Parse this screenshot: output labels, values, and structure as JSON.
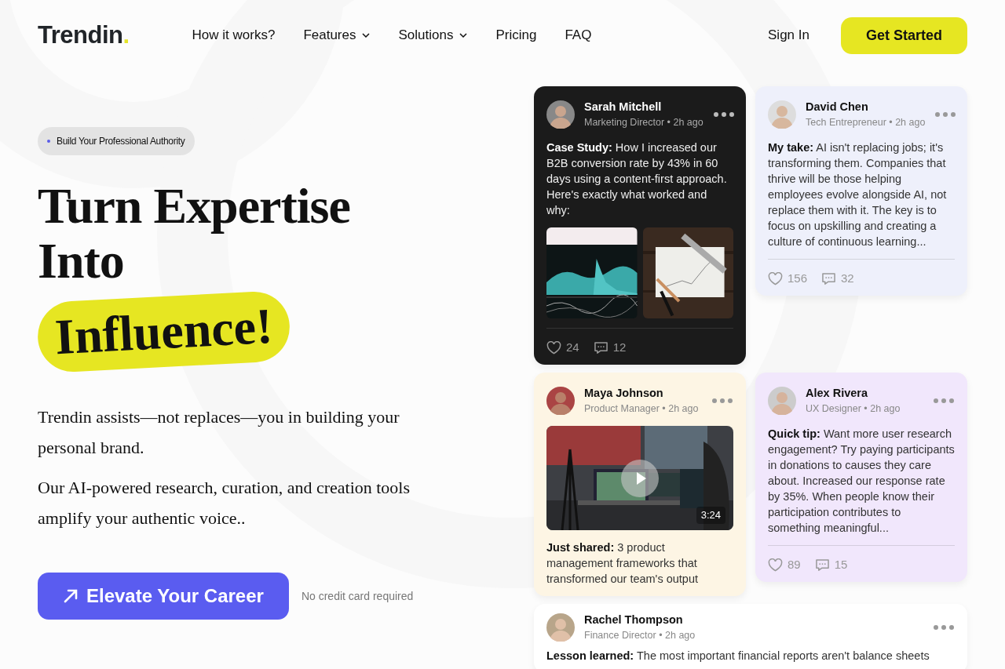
{
  "brand": {
    "name": "Trendin",
    "dot": "."
  },
  "nav": [
    {
      "label": "How it works?",
      "dropdown": false
    },
    {
      "label": "Features",
      "dropdown": true
    },
    {
      "label": "Solutions",
      "dropdown": true
    },
    {
      "label": "Pricing",
      "dropdown": false
    },
    {
      "label": "FAQ",
      "dropdown": false
    }
  ],
  "sign_in": "Sign In",
  "get_started": "Get Started",
  "hero": {
    "badge": "Build Your Professional Authority",
    "title": "Turn Expertise Into",
    "highlight": "Influence!",
    "paragraphs": [
      "Trendin assists—not replaces—you in building your personal brand.",
      "Our AI-powered research, curation, and creation tools amplify your authentic voice.."
    ],
    "cta": "Elevate Your Career",
    "note": "No credit card required"
  },
  "posts": [
    {
      "color": "#1b1b1b",
      "author": "Sarah Mitchell",
      "meta": "Marketing Director • 2h ago",
      "text": "**Case Study:** How I increased our B2B conversion rate by 43% in 60 days using a content-first approach. Here's exactly what worked and why:",
      "media": {
        "kind": "images"
      },
      "likes": "24",
      "comments": "12"
    },
    {
      "color": "#eef0fb",
      "author": "David Chen",
      "meta": "Tech Entrepreneur • 2h ago",
      "text": "**My take:** AI isn't replacing jobs; it's transforming them. Companies that thrive will be those helping employees evolve alongside AI, not replace them with it. The key is to focus on upskilling and creating a culture of continuous learning...",
      "likes": "156",
      "comments": "32"
    },
    {
      "color": "#fdf5e4",
      "author": "Maya Johnson",
      "meta": "Product Manager • 2h ago",
      "media": {
        "kind": "video",
        "duration": "3:24"
      },
      "text": "**Just shared:** 3 product management frameworks that transformed our team's output"
    },
    {
      "color": "#f1e7fc",
      "author": "Alex Rivera",
      "meta": "UX Designer • 2h ago",
      "text": "**Quick tip:** Want more user research engagement? Try paying participants in donations to causes they care about. Increased our response rate by 35%. When people know their participation contributes to something meaningful...",
      "likes": "89",
      "comments": "15"
    },
    {
      "color": "#ffffff",
      "author": "Rachel Thompson",
      "meta": "Finance Director • 2h ago",
      "text": "**Lesson learned:** The most important financial reports aren't balance sheets"
    }
  ]
}
